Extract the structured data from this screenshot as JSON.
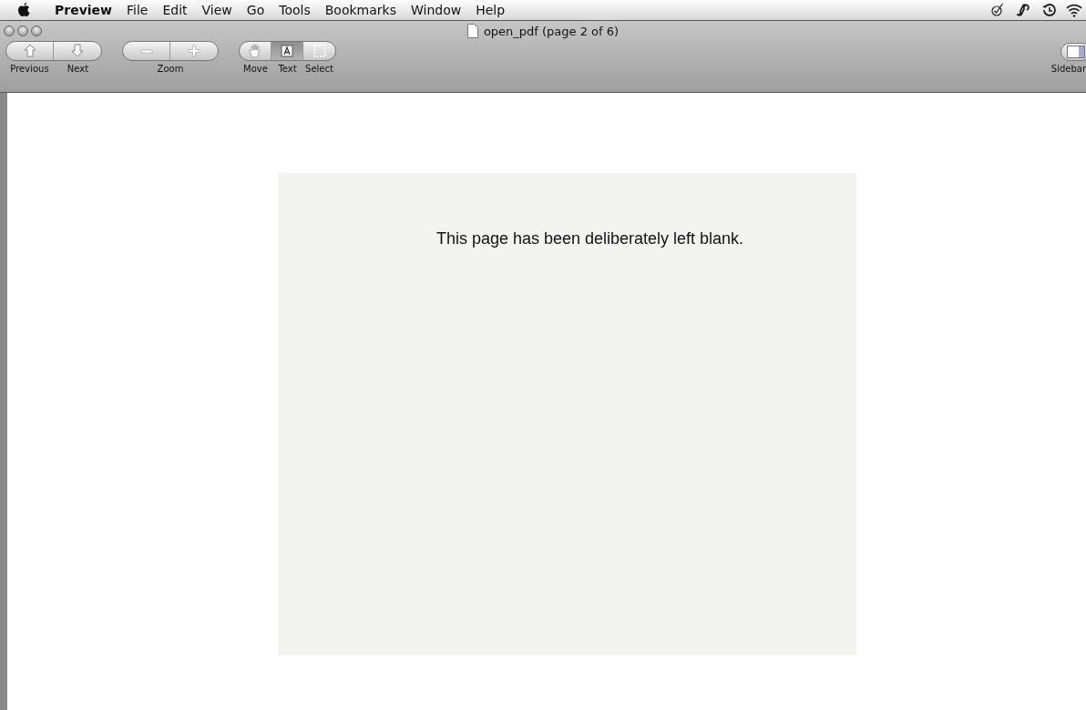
{
  "menu_bar": {
    "app_name": "Preview",
    "items": [
      "File",
      "Edit",
      "View",
      "Go",
      "Tools",
      "Bookmarks",
      "Window",
      "Help"
    ]
  },
  "window": {
    "title": "open_pdf (page 2 of 6)"
  },
  "toolbar": {
    "navigation": [
      "Previous",
      "Next"
    ],
    "zoom_caption": "Zoom",
    "tools": [
      {
        "label": "Move",
        "selected": false
      },
      {
        "label": "Text",
        "selected": true
      },
      {
        "label": "Select",
        "selected": false
      }
    ],
    "sidebar_label": "Sidebar"
  },
  "document": {
    "page_text": "This page has been deliberately left blank."
  }
}
